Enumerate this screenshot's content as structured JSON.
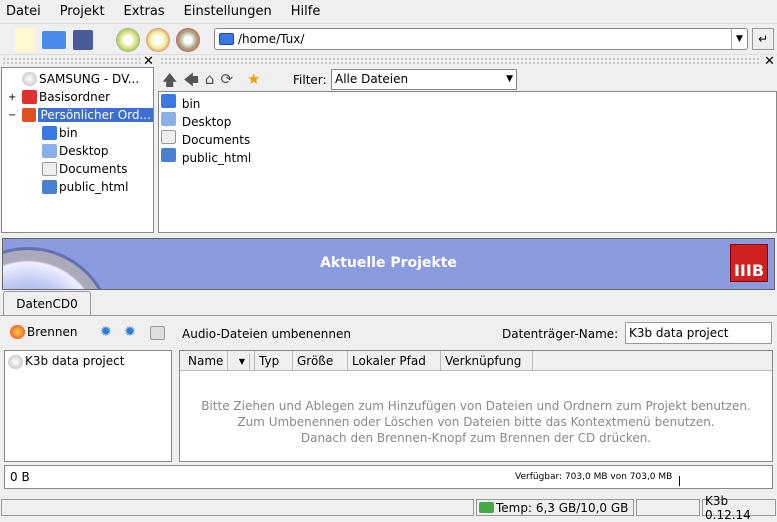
{
  "menu": [
    "Datei",
    "Projekt",
    "Extras",
    "Einstellungen",
    "Hilfe"
  ],
  "location": {
    "value": "/home/Tux/"
  },
  "tree": [
    {
      "label": "SAMSUNG - DV...",
      "icon": "cdrom-icon"
    },
    {
      "label": "Basisordner",
      "icon": "folder-red-icon",
      "expander": "+"
    },
    {
      "label": "Persönlicher Ord...",
      "icon": "home-icon",
      "expander": "−",
      "selected": true
    },
    {
      "label": "bin",
      "icon": "folder-icon"
    },
    {
      "label": "Desktop",
      "icon": "desktop-icon"
    },
    {
      "label": "Documents",
      "icon": "document-icon"
    },
    {
      "label": "public_html",
      "icon": "web-folder-icon"
    }
  ],
  "filebrowser": {
    "filter_label": "Filter:",
    "filter_value": "Alle Dateien",
    "files": [
      "bin",
      "Desktop",
      "Documents",
      "public_html"
    ]
  },
  "banner": {
    "title": "Aktuelle Projekte"
  },
  "tab": "DatenCD0",
  "project": {
    "burn_label": "Brennen",
    "rename_audio": "Audio-Dateien umbenennen",
    "volume_label": "Datenträger-Name:",
    "volume_value": "K3b data project",
    "root": "K3b data project",
    "columns": [
      "Name",
      "Typ",
      "Größe",
      "Lokaler Pfad",
      "Verknüpfung"
    ],
    "hint": [
      "Bitte Ziehen und Ablegen zum Hinzufügen von Dateien und Ordnern zum Projekt benutzen.",
      "Zum Umbenennen oder Löschen von Dateien bitte das Kontextmenü benutzen.",
      "Danach den Brennen-Knopf zum Brennen der CD drücken."
    ],
    "size": "0 B",
    "available": "Verfügbar: 703,0 MB von 703,0 MB",
    "used_fraction": 0
  },
  "status": {
    "temp": "Temp: 6,3 GB/10,0 GB",
    "version": "K3b 0.12.14"
  },
  "colors": {
    "banner": "#8a9be0",
    "selection": "#3c6fd0"
  }
}
